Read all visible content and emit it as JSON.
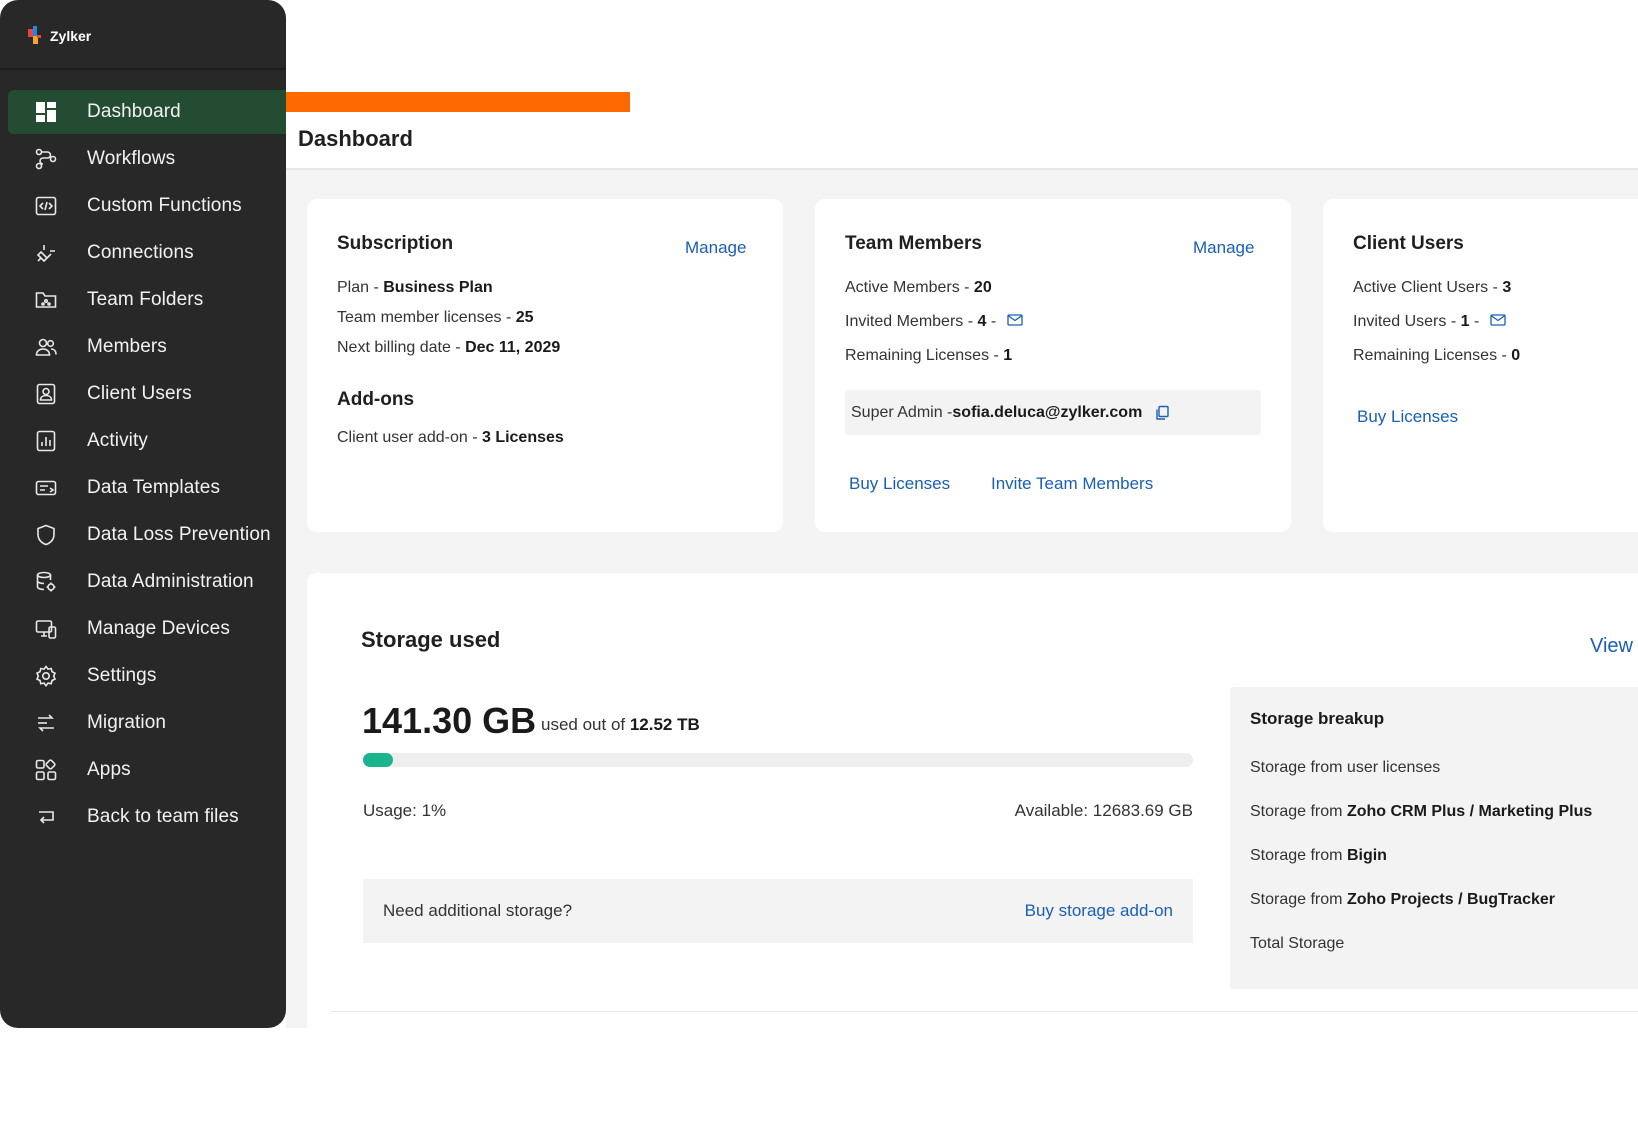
{
  "brand": {
    "name": "Zylker"
  },
  "sidebar": {
    "items": [
      {
        "label": "Dashboard",
        "icon": "dashboard-icon",
        "active": true
      },
      {
        "label": "Workflows",
        "icon": "workflow-icon",
        "active": false
      },
      {
        "label": "Custom Functions",
        "icon": "code-icon",
        "active": false
      },
      {
        "label": "Connections",
        "icon": "plug-icon",
        "active": false
      },
      {
        "label": "Team Folders",
        "icon": "team-folder-icon",
        "active": false
      },
      {
        "label": "Members",
        "icon": "members-icon",
        "active": false
      },
      {
        "label": "Client Users",
        "icon": "client-user-icon",
        "active": false
      },
      {
        "label": "Activity",
        "icon": "activity-icon",
        "active": false
      },
      {
        "label": "Data Templates",
        "icon": "template-icon",
        "active": false
      },
      {
        "label": "Data Loss Prevention",
        "icon": "shield-icon",
        "active": false
      },
      {
        "label": "Data Administration",
        "icon": "database-gear-icon",
        "active": false
      },
      {
        "label": "Manage Devices",
        "icon": "devices-icon",
        "active": false
      },
      {
        "label": "Settings",
        "icon": "gear-icon",
        "active": false
      },
      {
        "label": "Migration",
        "icon": "migration-icon",
        "active": false
      },
      {
        "label": "Apps",
        "icon": "apps-icon",
        "active": false
      },
      {
        "label": "Back to team files",
        "icon": "back-arrow-icon",
        "active": false
      }
    ]
  },
  "header": {
    "title": "Dashboard"
  },
  "subscription": {
    "title": "Subscription",
    "manage": "Manage",
    "plan_label": "Plan - ",
    "plan_value": "Business Plan",
    "licenses_label": "Team member licenses - ",
    "licenses_value": "25",
    "billing_label": "Next billing date - ",
    "billing_value": "Dec 11, 2029",
    "addons_title": "Add-ons",
    "addon_label": "Client user add-on - ",
    "addon_value": "3 Licenses"
  },
  "team_members": {
    "title": "Team Members",
    "manage": "Manage",
    "active_label": "Active Members - ",
    "active_value": "20",
    "invited_label": "Invited Members - ",
    "invited_value": "4",
    "invited_suffix": " -",
    "remaining_label": "Remaining Licenses - ",
    "remaining_value": "1",
    "admin_label": "Super Admin - ",
    "admin_email": "sofia.deluca@zylker.com",
    "buy_licenses": "Buy Licenses",
    "invite": "Invite Team Members"
  },
  "client_users": {
    "title": "Client Users",
    "active_label": "Active Client Users - ",
    "active_value": "3",
    "invited_label": "Invited Users - ",
    "invited_value": "1",
    "invited_suffix": " -",
    "remaining_label": "Remaining Licenses - ",
    "remaining_value": "0",
    "buy_licenses": "Buy Licenses"
  },
  "storage": {
    "title": "Storage used",
    "view": "View",
    "used": "141.30 GB",
    "used_of_label": "used out of ",
    "total": "12.52 TB",
    "usage_fraction": 0.01,
    "usage_text": "Usage: 1%",
    "available_text": "Available: 12683.69 GB",
    "need_more": "Need additional storage?",
    "buy_addon": "Buy storage add-on",
    "accent": "#1bb58d"
  },
  "breakup": {
    "title": "Storage breakup",
    "from": "Storage from ",
    "user_licenses": "Storage from user licenses",
    "crm_value": "Zoho CRM Plus / Marketing Plus",
    "bigin_value": "Bigin",
    "projects_value": "Zoho Projects / BugTracker",
    "total": "Total Storage"
  },
  "colors": {
    "sidebar": "#282828",
    "active": "#234c33",
    "accent_bar": "#ff6a00",
    "link": "#1a5fb4"
  }
}
